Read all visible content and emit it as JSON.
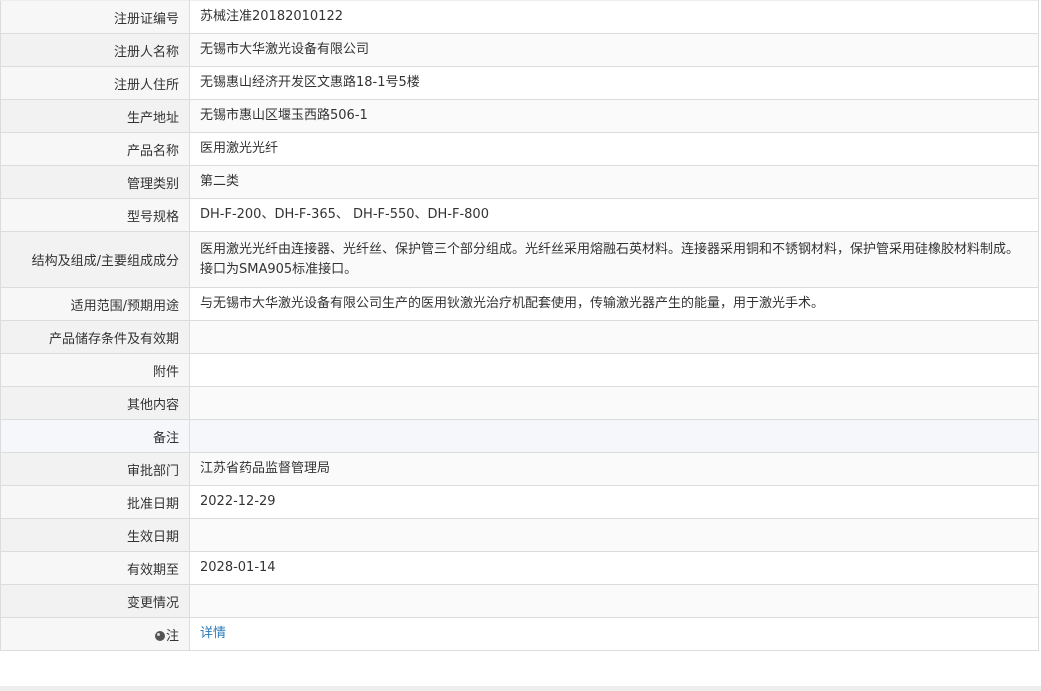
{
  "rows": [
    {
      "label": "注册证编号",
      "value": "苏械注准20182010122"
    },
    {
      "label": "注册人名称",
      "value": "无锡市大华激光设备有限公司"
    },
    {
      "label": "注册人住所",
      "value": "无锡惠山经济开发区文惠路18-1号5楼"
    },
    {
      "label": "生产地址",
      "value": "无锡市惠山区堰玉西路506-1"
    },
    {
      "label": "产品名称",
      "value": "医用激光光纤"
    },
    {
      "label": "管理类别",
      "value": "第二类"
    },
    {
      "label": "型号规格",
      "value": "DH-F-200、DH-F-365、 DH-F-550、DH-F-800"
    },
    {
      "label": "结构及组成/主要组成成分",
      "value": "医用激光光纤由连接器、光纤丝、保护管三个部分组成。光纤丝采用熔融石英材料。连接器采用铜和不锈钢材料，保护管采用硅橡胶材料制成。接口为SMA905标准接口。"
    },
    {
      "label": "适用范围/预期用途",
      "value": "与无锡市大华激光设备有限公司生产的医用钬激光治疗机配套使用，传输激光器产生的能量，用于激光手术。"
    },
    {
      "label": "产品储存条件及有效期",
      "value": ""
    },
    {
      "label": "附件",
      "value": ""
    },
    {
      "label": "其他内容",
      "value": ""
    },
    {
      "label": "备注",
      "value": ""
    },
    {
      "label": "审批部门",
      "value": "江苏省药品监督管理局"
    },
    {
      "label": "批准日期",
      "value": "2022-12-29"
    },
    {
      "label": "生效日期",
      "value": ""
    },
    {
      "label": "有效期至",
      "value": "2028-01-14"
    },
    {
      "label": "变更情况",
      "value": ""
    }
  ],
  "note": {
    "icon": "pin-icon",
    "label": "注",
    "link_text": "详情"
  }
}
